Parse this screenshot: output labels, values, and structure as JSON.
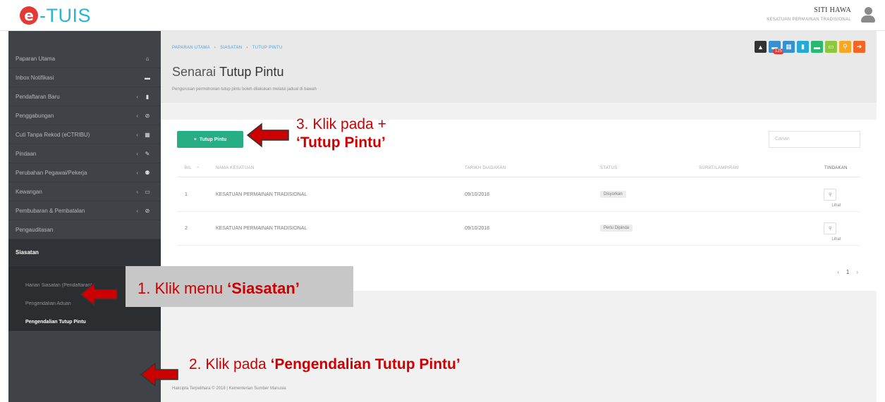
{
  "header": {
    "logo_mark": "e",
    "logo_text": "-TUIS",
    "user_name": "SITI HAWA",
    "user_org": "KESATUAN PERMAINAN TRADISIONAL"
  },
  "sidebar": {
    "items": [
      {
        "label": "Paparan Utama",
        "icon": "home-icon",
        "glyph": "⌂",
        "has_chevron": false
      },
      {
        "label": "Inbox Notifikasi",
        "icon": "inbox-icon",
        "glyph": "▬",
        "has_chevron": false
      },
      {
        "label": "Pendaftaran Baru",
        "icon": "file-icon",
        "glyph": "▮",
        "has_chevron": true
      },
      {
        "label": "Penggabungan",
        "icon": "link-icon",
        "glyph": "⊘",
        "has_chevron": true
      },
      {
        "label": "Cuti Tanpa Rekod (eCTRIBU)",
        "icon": "calendar-icon",
        "glyph": "▦",
        "has_chevron": true
      },
      {
        "label": "Pindaan",
        "icon": "edit-icon",
        "glyph": "✎",
        "has_chevron": true
      },
      {
        "label": "Perubahan Pegawai/Pekerja",
        "icon": "users-icon",
        "glyph": "⚉",
        "has_chevron": true
      },
      {
        "label": "Kewangan",
        "icon": "money-icon",
        "glyph": "▭",
        "has_chevron": true
      },
      {
        "label": "Pembubaran & Pembatalan",
        "icon": "ban-icon",
        "glyph": "⊘",
        "has_chevron": true
      },
      {
        "label": "Pengauditasan",
        "icon": "audit-icon",
        "glyph": "",
        "has_chevron": false
      },
      {
        "label": "Siasatan",
        "icon": "chevron-icon",
        "glyph": "",
        "has_chevron": false
      }
    ],
    "submenu": [
      {
        "label": "Harian Siasatan (Pendaftaran)"
      },
      {
        "label": "Pengendalian Aduan"
      },
      {
        "label": "Pengendalian Tutup Pintu"
      }
    ]
  },
  "page": {
    "breadcrumb": [
      "PAPARAN UTAMA",
      "SIASATAN",
      "TUTUP PINTU"
    ],
    "title_prefix": "Senarai",
    "title_main": "Tutup Pintu",
    "subtitle": "Pengurusan permohonan tutup pintu boleh dilakukan melalui jadual di bawah",
    "add_button": "Tutup Pintu",
    "search_placeholder": "Carian",
    "columns": [
      "BIL",
      "NAMA KESATUAN",
      "TARIKH DIADAKAN",
      "STATUS",
      "SURAT/LAMPIRAN",
      "TINDAKAN"
    ],
    "rows": [
      {
        "bil": "1",
        "nama": "KESATUAN PERMAINAN TRADISIONAL",
        "tarikh": "09/10/2018",
        "status": "Disyorkan",
        "action": "Lihat"
      },
      {
        "bil": "2",
        "nama": "KESATUAN PERMAINAN TRADISIONAL",
        "tarikh": "09/10/2018",
        "status": "Perlu Dipinda",
        "action": "Lihat"
      }
    ],
    "pager": {
      "prev": "‹",
      "current": "1",
      "next": "›"
    },
    "footer": "Hakcipta Terpelihara © 2018 | Kementerian Sumber Manusia",
    "quick_badge": "125"
  },
  "quick_buttons": [
    {
      "icon": "user-icon",
      "glyph": "▲",
      "color": "#333333"
    },
    {
      "icon": "comment-icon",
      "glyph": "▬",
      "color": "#3a8fd1"
    },
    {
      "icon": "calendar-icon",
      "glyph": "▦",
      "color": "#3a8fd1"
    },
    {
      "icon": "file-icon",
      "glyph": "▮",
      "color": "#26a9d6"
    },
    {
      "icon": "folder-icon",
      "glyph": "▬",
      "color": "#2bb673"
    },
    {
      "icon": "money-icon",
      "glyph": "▭",
      "color": "#8dc63f"
    },
    {
      "icon": "search-icon",
      "glyph": "⚲",
      "color": "#f7a823"
    },
    {
      "icon": "logout-icon",
      "glyph": "➔",
      "color": "#f26522"
    }
  ],
  "annotations": {
    "step1_prefix": "1. Klik menu ",
    "step1_bold": "‘Siasatan’",
    "step2_prefix": "2. Klik pada ",
    "step2_bold": "‘Pengendalian Tutup Pintu’",
    "step3_line1": "3. Klik pada +",
    "step3_line2": "‘Tutup Pintu’",
    "arrow_color": "#cc0000"
  }
}
